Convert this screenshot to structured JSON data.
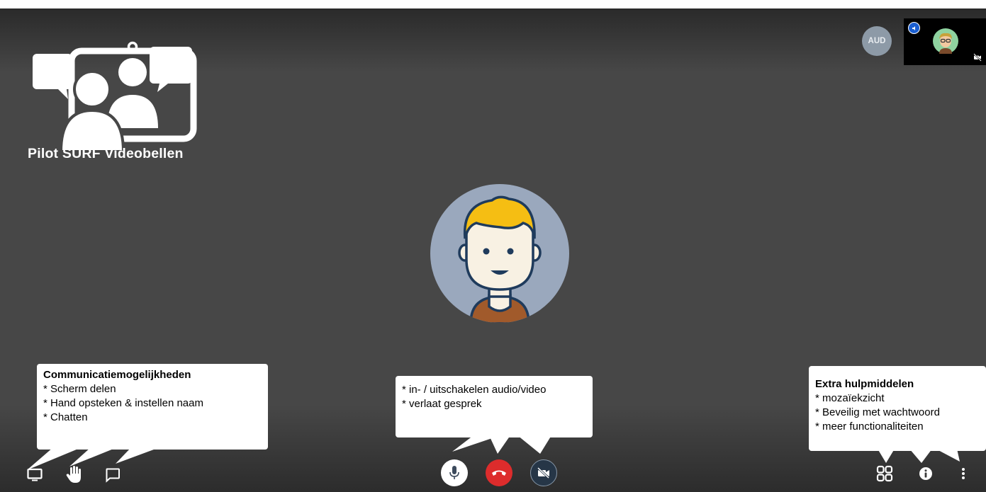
{
  "app": {
    "title": "Pilot SURF Videobellen"
  },
  "participants": {
    "audio_badge": "AUD"
  },
  "callouts": {
    "left": {
      "heading": "Communicatiemogelijkheden",
      "items": [
        "* Scherm delen",
        "* Hand opsteken & instellen naam",
        "* Chatten"
      ]
    },
    "center": {
      "items": [
        "* in- / uitschakelen audio/video",
        "* verlaat gesprek"
      ]
    },
    "right": {
      "heading": "Extra hulpmiddelen",
      "items": [
        "* mozaïekzicht",
        "* Beveilig met wachtwoord",
        "* meer functionaliteiten"
      ]
    }
  },
  "toolbar": {
    "left": [
      "screen-share-icon",
      "raise-hand-icon",
      "chat-icon"
    ],
    "center": [
      "microphone-icon",
      "hangup-icon",
      "camera-off-icon"
    ],
    "right": [
      "tile-view-icon",
      "info-icon",
      "more-vertical-icon"
    ]
  },
  "colors": {
    "background": "#474747",
    "hangup": "#dd2c2c",
    "video_button": "#263647",
    "audio_badge": "#8d9aa7",
    "self_indicator": "#1b5fd1",
    "avatar_bg": "#9aa8bd",
    "avatar_hair": "#f5be13",
    "avatar_shirt": "#a15a2b"
  }
}
